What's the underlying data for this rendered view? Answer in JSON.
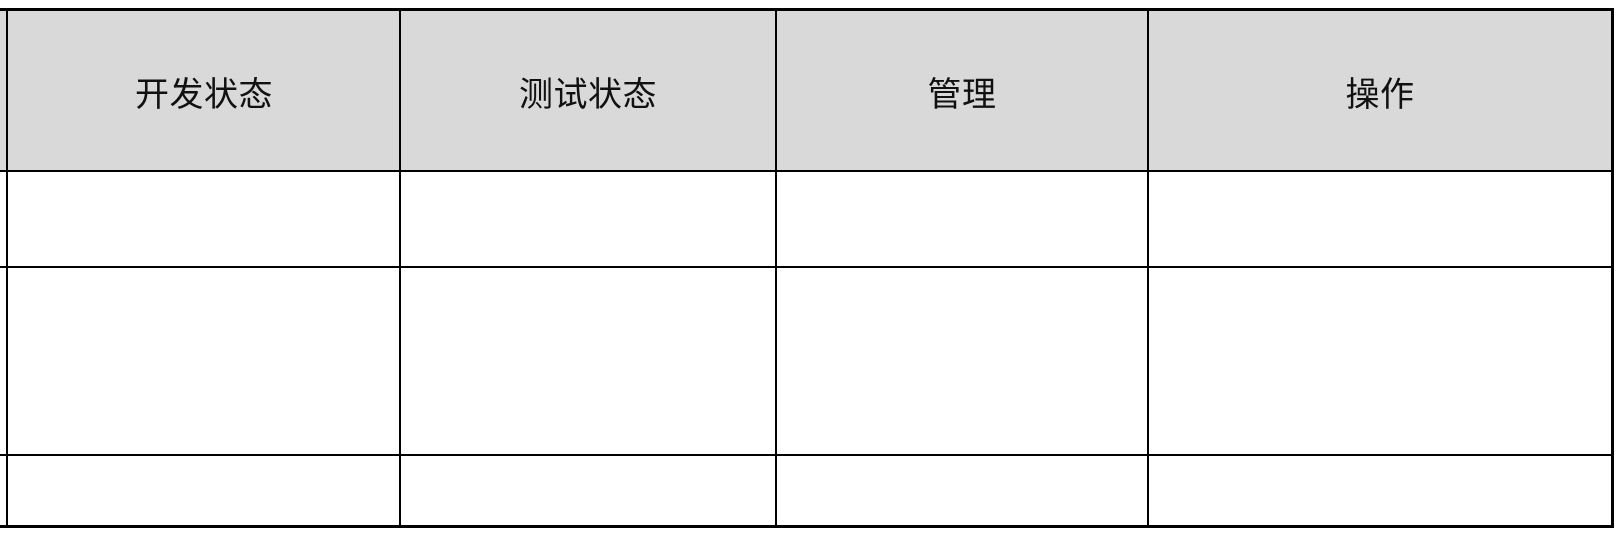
{
  "table": {
    "columns": [
      "开发状态",
      "测试状态",
      "管理",
      "操作"
    ],
    "rows": [
      [
        "",
        "",
        "",
        ""
      ],
      [
        "",
        "",
        "",
        ""
      ],
      [
        "",
        "",
        "",
        ""
      ]
    ],
    "header_background": "#d9d9d9",
    "border_color": "#000000"
  }
}
